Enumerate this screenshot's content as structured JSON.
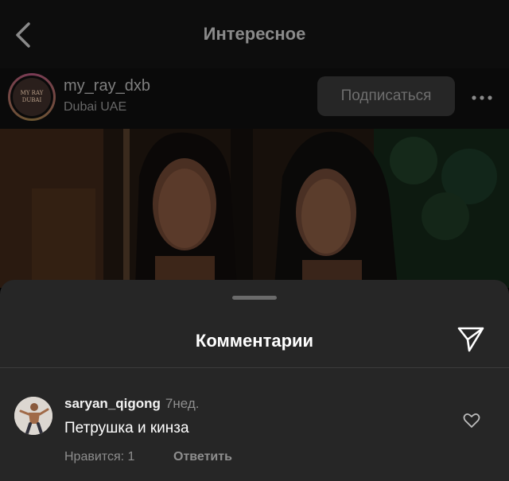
{
  "topbar": {
    "title": "Интересное"
  },
  "post": {
    "username": "my_ray_dxb",
    "location": "Dubai UAE",
    "follow_label": "Подписаться",
    "avatar_logo_text": "MY RAY DUBAI"
  },
  "comments_sheet": {
    "title": "Комментарии",
    "comments": [
      {
        "username": "saryan_qigong",
        "time": "7нед.",
        "text": "Петрушка и кинза",
        "likes_label": "Нравится: 1",
        "reply_label": "Ответить"
      }
    ]
  },
  "icons": {
    "back": "chevron-left-icon",
    "more": "more-horizontal-icon",
    "send": "paper-plane-icon",
    "like": "heart-icon"
  },
  "colors": {
    "background": "#000000",
    "sheet": "#262626",
    "muted_text": "#8e8e8e",
    "primary_text": "#ffffff"
  }
}
